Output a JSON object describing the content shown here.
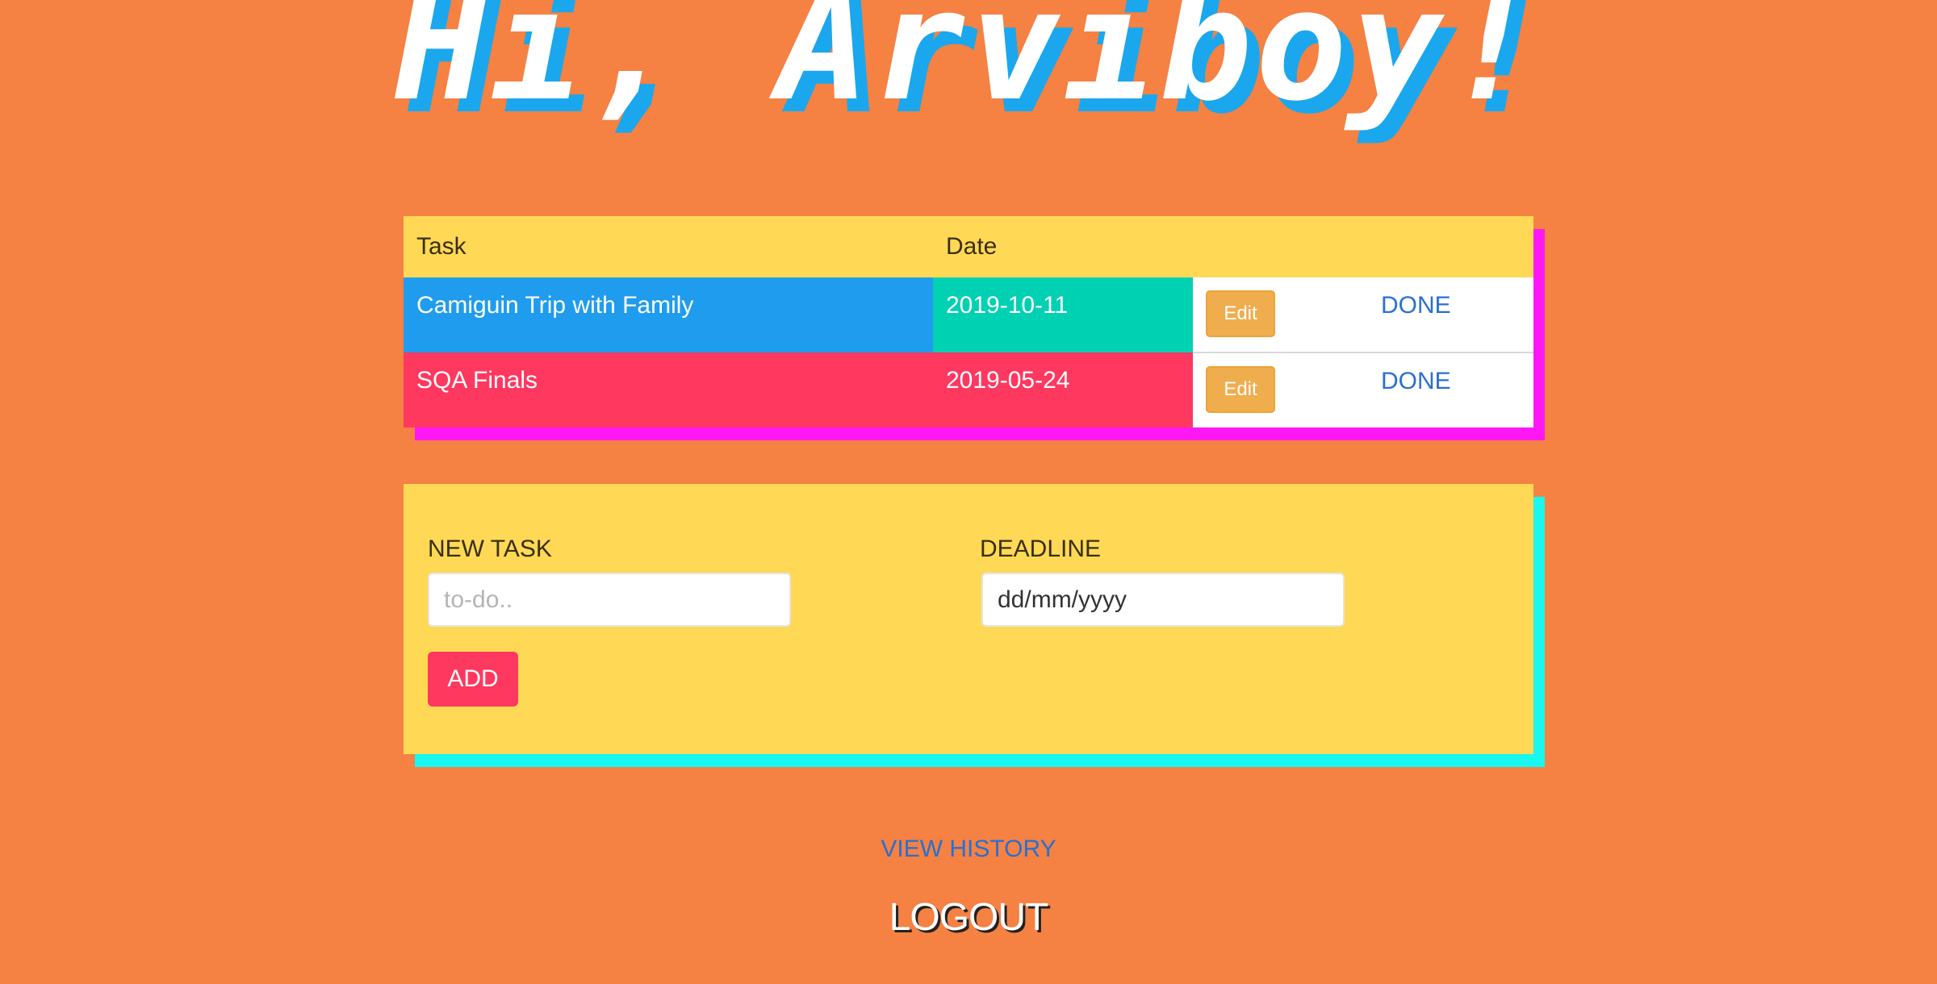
{
  "header": {
    "greeting": "Hi, Arviboy!"
  },
  "tasks_table": {
    "columns": [
      "Task",
      "Date"
    ],
    "rows": [
      {
        "task": "Camiguin Trip with Family",
        "date": "2019-10-11",
        "edit_label": "Edit",
        "done_label": "DONE",
        "color": "#209cee",
        "date_color": "#00d1b2"
      },
      {
        "task": "SQA Finals",
        "date": "2019-05-24",
        "edit_label": "Edit",
        "done_label": "DONE",
        "color": "#ff3860",
        "date_color": "#ff3860"
      }
    ]
  },
  "new_task_form": {
    "task_label": "NEW TASK",
    "task_placeholder": "to-do..",
    "task_value": "",
    "deadline_label": "DEADLINE",
    "deadline_value": "dd/mm/yyyy",
    "add_label": "ADD"
  },
  "footer": {
    "history_label": "VIEW HISTORY",
    "logout_label": "LOGOUT"
  },
  "colors": {
    "background": "#f58143",
    "header_yellow": "#ffd956",
    "table_shadow": "#ff18f5",
    "form_shadow": "#18f7f0",
    "greeting_shadow": "#1aa7ee",
    "link_blue": "#2a6fd0"
  }
}
